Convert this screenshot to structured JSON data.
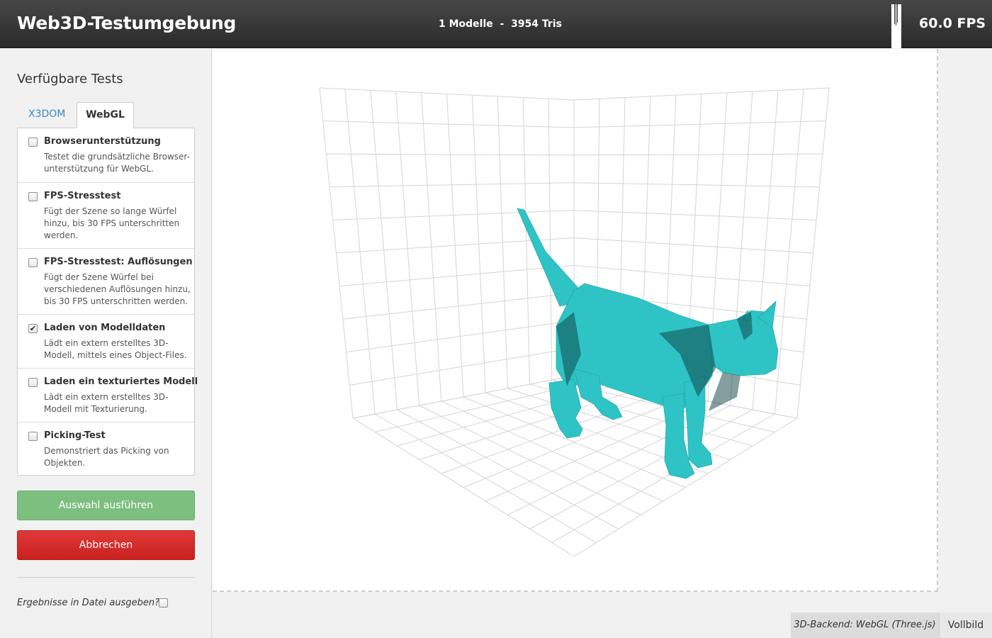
{
  "header": {
    "title": "Web3D-Testumgebung",
    "stats": "1 Modelle  -  3954 Tris",
    "fps": "60.0 FPS",
    "fps_graph_icon": "fps-graph-icon"
  },
  "sidebar": {
    "title": "Verfügbare Tests",
    "tabs": [
      {
        "label": "X3DOM",
        "active": false
      },
      {
        "label": "WebGL",
        "active": true
      }
    ],
    "tests": [
      {
        "name": "Browserunterstützung",
        "description": "Testet die grundsätzliche Browser-unterstützung für WebGL.",
        "checked": false
      },
      {
        "name": "FPS-Stresstest",
        "description": "Fügt der Szene so lange Würfel hinzu, bis 30 FPS unterschritten werden.",
        "checked": false
      },
      {
        "name": "FPS-Stresstest: Auflösungen",
        "description": "Fügt der Szene Würfel bei verschiedenen Auflösungen hinzu, bis 30 FPS unterschritten werden.",
        "checked": false
      },
      {
        "name": "Laden von Modelldaten",
        "description": "Lädt ein extern erstelltes 3D-Modell, mittels eines Object-Files.",
        "checked": true
      },
      {
        "name": "Laden ein texturiertes Modell",
        "description": "Lädt ein extern erstelltes 3D-Modell mit Texturierung.",
        "checked": false
      },
      {
        "name": "Picking-Test",
        "description": "Demonstriert das Picking von Objekten.",
        "checked": false
      }
    ],
    "run_button": "Auswahl ausführen",
    "cancel_button": "Abbrechen",
    "export_label": "Ergebnisse in Datei ausgeben?",
    "export_checked": false
  },
  "viewport": {
    "model": "cat",
    "model_color": "#2ec4c6",
    "grid_color": "#d4d4d4"
  },
  "footer": {
    "backend": "3D-Backend: WebGL (Three.js)",
    "fullscreen": "Vollbild"
  },
  "colors": {
    "accent_green": "#7cbf7e",
    "accent_red": "#d42c2a",
    "link_blue": "#3a87c7",
    "header_dark": "#333333"
  }
}
